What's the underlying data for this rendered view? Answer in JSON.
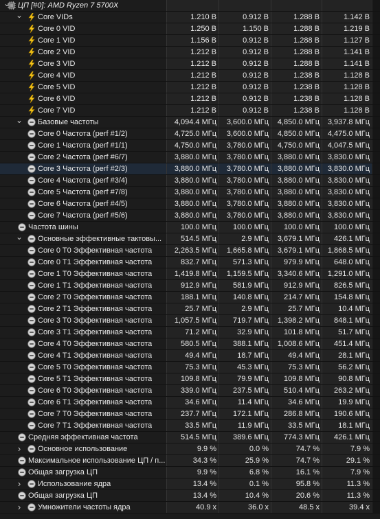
{
  "window": {
    "title": "ЦП [#0]: AMD Ryzen 7 5700X"
  },
  "rows": [
    {
      "level": 0,
      "expander": "down",
      "icon": "cpu",
      "label": "ЦП [#0]: AMD Ryzen 7 5700X",
      "header": true
    },
    {
      "level": 1,
      "expander": "down",
      "icon": "bolt",
      "label": "Core VIDs",
      "v": [
        "1.210 В",
        "0.912 В",
        "1.288 В",
        "1.142 В"
      ]
    },
    {
      "level": 2,
      "icon": "bolt",
      "label": "Core 0 VID",
      "v": [
        "1.250 В",
        "1.150 В",
        "1.288 В",
        "1.219 В"
      ]
    },
    {
      "level": 2,
      "icon": "bolt",
      "label": "Core 1 VID",
      "v": [
        "1.156 В",
        "0.912 В",
        "1.288 В",
        "1.127 В"
      ]
    },
    {
      "level": 2,
      "icon": "bolt",
      "label": "Core 2 VID",
      "v": [
        "1.212 В",
        "0.912 В",
        "1.288 В",
        "1.141 В"
      ]
    },
    {
      "level": 2,
      "icon": "bolt",
      "label": "Core 3 VID",
      "v": [
        "1.212 В",
        "0.912 В",
        "1.288 В",
        "1.141 В"
      ]
    },
    {
      "level": 2,
      "icon": "bolt",
      "label": "Core 4 VID",
      "v": [
        "1.212 В",
        "0.912 В",
        "1.238 В",
        "1.128 В"
      ]
    },
    {
      "level": 2,
      "icon": "bolt",
      "label": "Core 5 VID",
      "v": [
        "1.212 В",
        "0.912 В",
        "1.238 В",
        "1.128 В"
      ]
    },
    {
      "level": 2,
      "icon": "bolt",
      "label": "Core 6 VID",
      "v": [
        "1.212 В",
        "0.912 В",
        "1.238 В",
        "1.128 В"
      ]
    },
    {
      "level": 2,
      "icon": "bolt",
      "label": "Core 7 VID",
      "v": [
        "1.212 В",
        "0.912 В",
        "1.238 В",
        "1.128 В"
      ]
    },
    {
      "level": 1,
      "expander": "down",
      "icon": "clock",
      "label": "Базовые частоты",
      "v": [
        "4,094.4 МГц",
        "3,600.0 МГц",
        "4,850.0 МГц",
        "3,937.8 МГц"
      ]
    },
    {
      "level": 2,
      "icon": "clock",
      "label": "Core 0 Частота (perf #1/2)",
      "v": [
        "4,725.0 МГц",
        "3,600.0 МГц",
        "4,850.0 МГц",
        "4,475.0 МГц"
      ]
    },
    {
      "level": 2,
      "icon": "clock",
      "label": "Core 1 Частота (perf #1/1)",
      "v": [
        "4,750.0 МГц",
        "3,780.0 МГц",
        "4,750.0 МГц",
        "4,047.5 МГц"
      ]
    },
    {
      "level": 2,
      "icon": "clock",
      "label": "Core 2 Частота (perf #6/7)",
      "v": [
        "3,880.0 МГц",
        "3,780.0 МГц",
        "3,880.0 МГц",
        "3,830.0 МГц"
      ]
    },
    {
      "level": 2,
      "icon": "clock",
      "label": "Core 3 Частота (perf #2/3)",
      "v": [
        "3,880.0 МГц",
        "3,780.0 МГц",
        "3,880.0 МГц",
        "3,830.0 МГц"
      ],
      "selected": true
    },
    {
      "level": 2,
      "icon": "clock",
      "label": "Core 4 Частота (perf #3/4)",
      "v": [
        "3,880.0 МГц",
        "3,780.0 МГц",
        "3,880.0 МГц",
        "3,830.0 МГц"
      ]
    },
    {
      "level": 2,
      "icon": "clock",
      "label": "Core 5 Частота (perf #7/8)",
      "v": [
        "3,880.0 МГц",
        "3,780.0 МГц",
        "3,880.0 МГц",
        "3,830.0 МГц"
      ]
    },
    {
      "level": 2,
      "icon": "clock",
      "label": "Core 6 Частота (perf #4/5)",
      "v": [
        "3,880.0 МГц",
        "3,780.0 МГц",
        "3,880.0 МГц",
        "3,830.0 МГц"
      ]
    },
    {
      "level": 2,
      "icon": "clock",
      "label": "Core 7 Частота (perf #5/6)",
      "v": [
        "3,880.0 МГц",
        "3,780.0 МГц",
        "3,880.0 МГц",
        "3,830.0 МГц"
      ]
    },
    {
      "level": 1,
      "icon": "clock",
      "label": "Частота шины",
      "v": [
        "100.0 МГц",
        "100.0 МГц",
        "100.0 МГц",
        "100.0 МГц"
      ]
    },
    {
      "level": 1,
      "expander": "down",
      "icon": "clock",
      "label": "Основные эффективные тактовы...",
      "v": [
        "514.5 МГц",
        "2.9 МГц",
        "3,679.1 МГц",
        "426.1 МГц"
      ]
    },
    {
      "level": 2,
      "icon": "clock",
      "label": "Core 0 T0 Эффективная частота",
      "v": [
        "2,263.5 МГц",
        "1,665.8 МГц",
        "3,679.1 МГц",
        "1,868.5 МГц"
      ]
    },
    {
      "level": 2,
      "icon": "clock",
      "label": "Core 0 T1 Эффективная частота",
      "v": [
        "832.7 МГц",
        "571.3 МГц",
        "979.9 МГц",
        "648.0 МГц"
      ]
    },
    {
      "level": 2,
      "icon": "clock",
      "label": "Core 1 T0 Эффективная частота",
      "v": [
        "1,419.8 МГц",
        "1,159.5 МГц",
        "3,340.6 МГц",
        "1,291.0 МГц"
      ]
    },
    {
      "level": 2,
      "icon": "clock",
      "label": "Core 1 T1 Эффективная частота",
      "v": [
        "912.9 МГц",
        "581.9 МГц",
        "912.9 МГц",
        "826.5 МГц"
      ]
    },
    {
      "level": 2,
      "icon": "clock",
      "label": "Core 2 T0 Эффективная частота",
      "v": [
        "188.1 МГц",
        "140.8 МГц",
        "214.7 МГц",
        "154.8 МГц"
      ]
    },
    {
      "level": 2,
      "icon": "clock",
      "label": "Core 2 T1 Эффективная частота",
      "v": [
        "25.7 МГц",
        "2.9 МГц",
        "25.7 МГц",
        "10.4 МГц"
      ]
    },
    {
      "level": 2,
      "icon": "clock",
      "label": "Core 3 T0 Эффективная частота",
      "v": [
        "1,057.5 МГц",
        "719.7 МГц",
        "1,398.2 МГц",
        "848.1 МГц"
      ]
    },
    {
      "level": 2,
      "icon": "clock",
      "label": "Core 3 T1 Эффективная частота",
      "v": [
        "71.2 МГц",
        "32.9 МГц",
        "101.8 МГц",
        "51.7 МГц"
      ]
    },
    {
      "level": 2,
      "icon": "clock",
      "label": "Core 4 T0 Эффективная частота",
      "v": [
        "580.5 МГц",
        "388.1 МГц",
        "1,008.6 МГц",
        "451.4 МГц"
      ]
    },
    {
      "level": 2,
      "icon": "clock",
      "label": "Core 4 T1 Эффективная частота",
      "v": [
        "49.4 МГц",
        "18.7 МГц",
        "49.4 МГц",
        "28.1 МГц"
      ]
    },
    {
      "level": 2,
      "icon": "clock",
      "label": "Core 5 T0 Эффективная частота",
      "v": [
        "75.3 МГц",
        "45.3 МГц",
        "75.3 МГц",
        "56.2 МГц"
      ]
    },
    {
      "level": 2,
      "icon": "clock",
      "label": "Core 5 T1 Эффективная частота",
      "v": [
        "109.8 МГц",
        "79.9 МГц",
        "109.8 МГц",
        "90.8 МГц"
      ]
    },
    {
      "level": 2,
      "icon": "clock",
      "label": "Core 6 T0 Эффективная частота",
      "v": [
        "339.0 МГц",
        "237.5 МГц",
        "510.4 МГц",
        "263.2 МГц"
      ]
    },
    {
      "level": 2,
      "icon": "clock",
      "label": "Core 6 T1 Эффективная частота",
      "v": [
        "34.6 МГц",
        "11.4 МГц",
        "34.6 МГц",
        "19.9 МГц"
      ]
    },
    {
      "level": 2,
      "icon": "clock",
      "label": "Core 7 T0 Эффективная частота",
      "v": [
        "237.7 МГц",
        "172.1 МГц",
        "286.8 МГц",
        "190.6 МГц"
      ]
    },
    {
      "level": 2,
      "icon": "clock",
      "label": "Core 7 T1 Эффективная частота",
      "v": [
        "33.5 МГц",
        "11.9 МГц",
        "33.5 МГц",
        "18.1 МГц"
      ]
    },
    {
      "level": 1,
      "icon": "clock",
      "label": "Средняя эффективная частота",
      "v": [
        "514.5 МГц",
        "389.6 МГц",
        "774.3 МГц",
        "426.1 МГц"
      ]
    },
    {
      "level": 1,
      "expander": "right",
      "icon": "clock",
      "label": "Основное использование",
      "v": [
        "9.9 %",
        "0.0 %",
        "74.7 %",
        "7.9 %"
      ]
    },
    {
      "level": 1,
      "icon": "clock",
      "label": "Максимальное использование ЦП / п...",
      "v": [
        "34.3 %",
        "25.9 %",
        "74.7 %",
        "29.1 %"
      ]
    },
    {
      "level": 1,
      "icon": "clock",
      "label": "Общая загрузка ЦП",
      "v": [
        "9.9 %",
        "6.8 %",
        "16.1 %",
        "7.9 %"
      ]
    },
    {
      "level": 1,
      "expander": "right",
      "icon": "clock",
      "label": "Использование ядра",
      "v": [
        "13.4 %",
        "0.1 %",
        "95.8 %",
        "11.3 %"
      ]
    },
    {
      "level": 1,
      "icon": "clock",
      "label": "Общая загрузка ЦП",
      "v": [
        "13.4 %",
        "10.4 %",
        "20.6 %",
        "11.3 %"
      ]
    },
    {
      "level": 1,
      "expander": "right",
      "icon": "clock",
      "label": "Умножители частоты ядра",
      "v": [
        "40.9 x",
        "36.0 x",
        "48.5 x",
        "39.4 x"
      ]
    }
  ]
}
